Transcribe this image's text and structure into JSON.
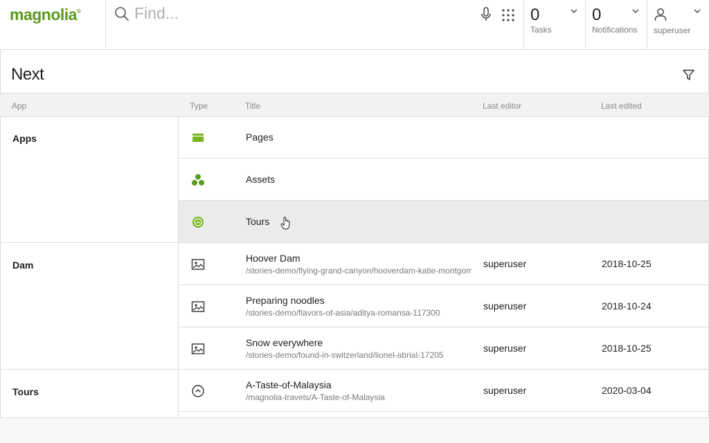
{
  "header": {
    "logo_text": "magnolia",
    "logo_mark": "®",
    "search": {
      "placeholder": "Find...",
      "value": ""
    },
    "tasks": {
      "count": "0",
      "label": "Tasks"
    },
    "notifications": {
      "count": "0",
      "label": "Notifications"
    },
    "user": {
      "label": "superuser"
    }
  },
  "page": {
    "title": "Next"
  },
  "table": {
    "columns": {
      "app": "App",
      "type": "Type",
      "title": "Title",
      "last_editor": "Last editor",
      "last_edited": "Last edited"
    },
    "groups": [
      {
        "label": "Apps"
      },
      {
        "label": "Dam"
      },
      {
        "label": "Tours"
      }
    ],
    "rows": [
      {
        "icon": "pages-app-icon",
        "title": "Pages",
        "path": "",
        "editor": "",
        "edited": ""
      },
      {
        "icon": "assets-app-icon",
        "title": "Assets",
        "path": "",
        "editor": "",
        "edited": ""
      },
      {
        "icon": "tours-app-icon",
        "title": "Tours",
        "path": "",
        "editor": "",
        "edited": ""
      },
      {
        "icon": "image-icon",
        "title": "Hoover Dam",
        "path": "/stories-demo/flying-grand-canyon/hooverdam-katie-montgomer",
        "editor": "superuser",
        "edited": "2018-10-25"
      },
      {
        "icon": "image-icon",
        "title": "Preparing noodles",
        "path": "/stories-demo/flavors-of-asia/aditya-romansa-117300",
        "editor": "superuser",
        "edited": "2018-10-24"
      },
      {
        "icon": "image-icon",
        "title": "Snow everywhere",
        "path": "/stories-demo/found-in-switzerland/lionel-abrial-17205",
        "editor": "superuser",
        "edited": "2018-10-25"
      },
      {
        "icon": "tour-icon",
        "title": "A-Taste-of-Malaysia",
        "path": "/magnolia-travels/A-Taste-of-Malaysia",
        "editor": "superuser",
        "edited": "2020-03-04"
      }
    ]
  },
  "colors": {
    "brand": "#5a9a1e",
    "accent": "#78b41e",
    "hover_row": "#ebebeb",
    "header_bg": "#f2f2f2"
  }
}
